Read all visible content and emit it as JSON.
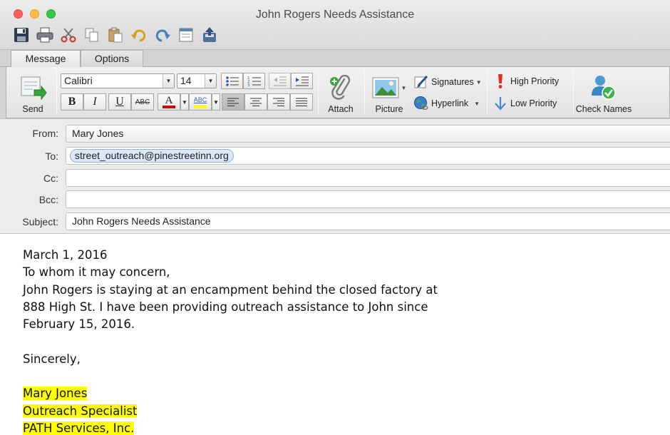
{
  "window": {
    "title": "John Rogers Needs Assistance"
  },
  "quick_toolbar": [
    "save-icon",
    "print-icon",
    "cut-icon",
    "copy-icon",
    "paste-icon",
    "undo-icon",
    "redo-icon",
    "form-icon",
    "upload-icon"
  ],
  "tabs": [
    {
      "label": "Message",
      "active": true
    },
    {
      "label": "Options",
      "active": false
    }
  ],
  "ribbon": {
    "send_label": "Send",
    "font_name": "Calibri",
    "font_size": "14",
    "attach_label": "Attach",
    "picture_label": "Picture",
    "signatures_label": "Signatures",
    "hyperlink_label": "Hyperlink",
    "high_priority_label": "High Priority",
    "low_priority_label": "Low Priority",
    "check_names_label": "Check Names",
    "bold_label": "B",
    "italic_label": "I",
    "underline_label": "U",
    "strike_label": "ABC",
    "font_color_label": "A",
    "highlight_label": "ABC",
    "font_color": "#d40000",
    "highlight_color": "#ffff00",
    "alignment_selected": "left"
  },
  "header": {
    "from_label": "From:",
    "from_value": "Mary Jones",
    "to_label": "To:",
    "to_recipient": "street_outreach@pinestreetinn.org",
    "cc_label": "Cc:",
    "cc_value": "",
    "bcc_label": "Bcc:",
    "bcc_value": "",
    "subject_label": "Subject:",
    "subject_value": "John Rogers Needs Assistance"
  },
  "body": {
    "lines": [
      "March 1, 2016",
      "To whom it may concern,",
      "John Rogers is staying at an encampment behind the closed factory at",
      "888 High St. I have been providing outreach assistance to John since",
      "February 15, 2016.",
      "",
      "Sincerely,",
      "",
      "Mary Jones",
      "Outreach Specialist",
      "PATH Services, Inc."
    ],
    "highlight_color": "#ffff00"
  }
}
